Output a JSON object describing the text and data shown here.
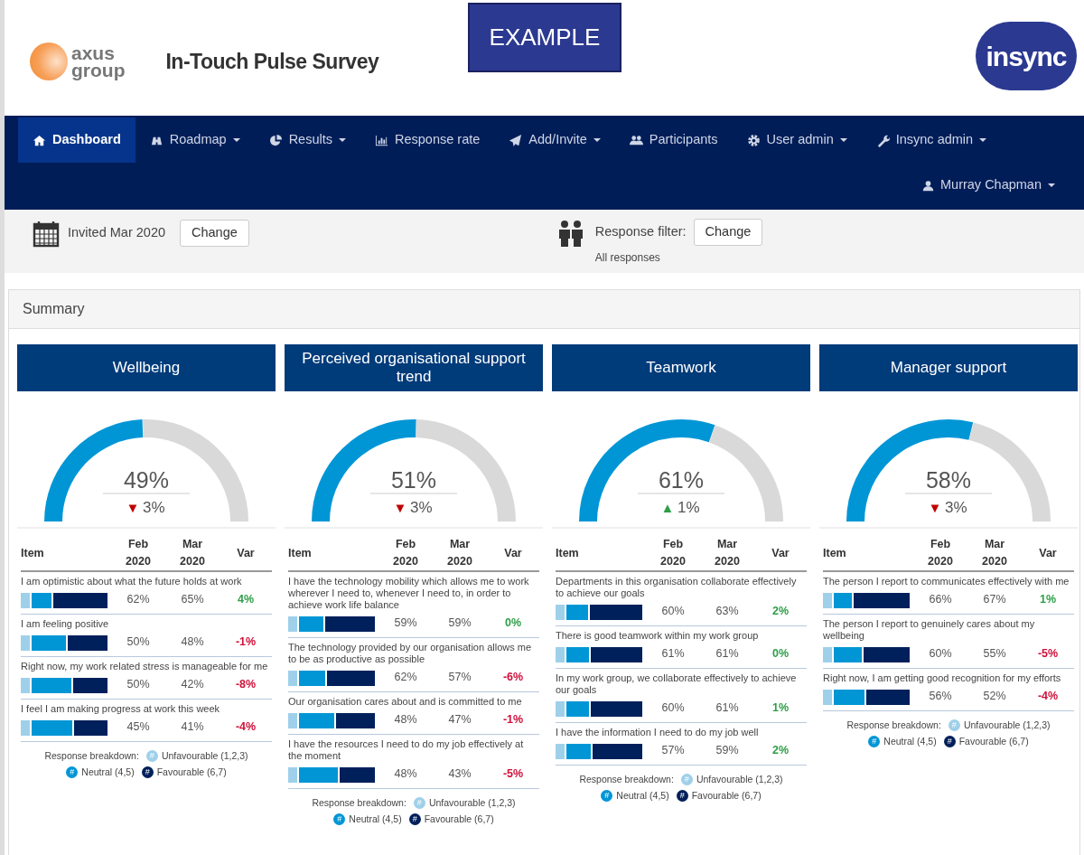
{
  "header": {
    "logo_top": "axus",
    "logo_bottom": "group",
    "title": "In-Touch Pulse Survey",
    "stamp": "EXAMPLE",
    "brand": "insync"
  },
  "nav": [
    {
      "label": "Dashboard",
      "caret": false,
      "selected": true
    },
    {
      "label": "Roadmap",
      "caret": true,
      "selected": false
    },
    {
      "label": "Results",
      "caret": true,
      "selected": false
    },
    {
      "label": "Response rate",
      "caret": false,
      "selected": false
    },
    {
      "label": "Add/Invite",
      "caret": true,
      "selected": false
    },
    {
      "label": "Participants",
      "caret": false,
      "selected": false
    },
    {
      "label": "User admin",
      "caret": true,
      "selected": false
    },
    {
      "label": "Insync admin",
      "caret": true,
      "selected": false
    }
  ],
  "user": {
    "label": "Murray Chapman",
    "caret": true
  },
  "filters": {
    "invited": "Invited Mar 2020",
    "invited_button": "Change",
    "response_label": "Response filter:",
    "response_button": "Change",
    "response_value": "All responses"
  },
  "summary": {
    "title": "Summary"
  },
  "cards": [
    {
      "title": "Wellbeing",
      "gauge": {
        "value": "49%",
        "arrow": "▼",
        "positive": false,
        "change": "3%"
      },
      "columns": [
        "Item",
        "Feb 2020",
        "Mar 2020",
        "Var"
      ],
      "items": [
        {
          "text": "I am optimistic about what the future holds at work",
          "feb": "62%",
          "mar": "65%",
          "var": "4%",
          "favourable": true
        },
        {
          "text": "I am feeling positive",
          "feb": "50%",
          "mar": "48%",
          "var": "-1%",
          "favourable": false
        },
        {
          "text": "Right now, my work related stress is manageable for me",
          "feb": "50%",
          "mar": "42%",
          "var": "-8%",
          "favourable": false
        },
        {
          "text": "I feel I am making progress at work this week",
          "feb": "45%",
          "mar": "41%",
          "var": "-4%",
          "favourable": false
        }
      ],
      "legend": {
        "label": "Response breakdown:",
        "items": [
          {
            "symbol": "#",
            "label": "Unfavourable (1,2,3)",
            "color": "#9fd0ea"
          },
          {
            "symbol": "#",
            "label": "Neutral (4,5)",
            "color": "#0096d6"
          },
          {
            "symbol": "#",
            "label": "Favourable (6,7)",
            "color": "#00205b"
          }
        ]
      }
    },
    {
      "title": "Perceived organisational support trend",
      "gauge": {
        "value": "51%",
        "arrow": "▼",
        "positive": false,
        "change": "3%"
      },
      "columns": [
        "Item",
        "Feb 2020",
        "Mar 2020",
        "Var"
      ],
      "items": [
        {
          "text": "I have the technology mobility which allows me to work wherever I need to, whenever I need to, in order to achieve work life balance",
          "feb": "59%",
          "mar": "59%",
          "var": "0%",
          "favourable": true
        },
        {
          "text": "The technology provided by our organisation allows me to be as productive as possible",
          "feb": "62%",
          "mar": "57%",
          "var": "-6%",
          "favourable": false
        },
        {
          "text": "Our organisation cares about and is committed to me",
          "feb": "48%",
          "mar": "47%",
          "var": "-1%",
          "favourable": false
        },
        {
          "text": "I have the resources I need to do my job effectively at the moment",
          "feb": "48%",
          "mar": "43%",
          "var": "-5%",
          "favourable": false
        }
      ],
      "legend": {
        "label": "Response breakdown:",
        "items": [
          {
            "symbol": "#",
            "label": "Unfavourable (1,2,3)",
            "color": "#9fd0ea"
          },
          {
            "symbol": "#",
            "label": "Neutral (4,5)",
            "color": "#0096d6"
          },
          {
            "symbol": "#",
            "label": "Favourable (6,7)",
            "color": "#00205b"
          }
        ]
      }
    },
    {
      "title": "Teamwork",
      "gauge": {
        "value": "61%",
        "arrow": "▲",
        "positive": true,
        "change": "1%"
      },
      "columns": [
        "Item",
        "Feb 2020",
        "Mar 2020",
        "Var"
      ],
      "items": [
        {
          "text": "Departments in this organisation collaborate effectively to achieve our goals",
          "feb": "60%",
          "mar": "63%",
          "var": "2%",
          "favourable": true
        },
        {
          "text": "There is good teamwork within my work group",
          "feb": "61%",
          "mar": "61%",
          "var": "0%",
          "favourable": true
        },
        {
          "text": "In my work group, we collaborate effectively to achieve our goals",
          "feb": "60%",
          "mar": "61%",
          "var": "1%",
          "favourable": true
        },
        {
          "text": "I have the information I need to do my job well",
          "feb": "57%",
          "mar": "59%",
          "var": "2%",
          "favourable": true
        }
      ],
      "legend": {
        "label": "Response breakdown:",
        "items": [
          {
            "symbol": "#",
            "label": "Unfavourable (1,2,3)",
            "color": "#9fd0ea"
          },
          {
            "symbol": "#",
            "label": "Neutral (4,5)",
            "color": "#0096d6"
          },
          {
            "symbol": "#",
            "label": "Favourable (6,7)",
            "color": "#00205b"
          }
        ]
      }
    },
    {
      "title": "Manager support",
      "gauge": {
        "value": "58%",
        "arrow": "▼",
        "positive": false,
        "change": "3%"
      },
      "columns": [
        "Item",
        "Feb 2020",
        "Mar 2020",
        "Var"
      ],
      "items": [
        {
          "text": "The person I report to communicates effectively with me",
          "feb": "66%",
          "mar": "67%",
          "var": "1%",
          "favourable": true
        },
        {
          "text": "The person I report to genuinely cares about my wellbeing",
          "feb": "60%",
          "mar": "55%",
          "var": "-5%",
          "favourable": false
        },
        {
          "text": "Right now, I am getting good recognition for my efforts",
          "feb": "56%",
          "mar": "52%",
          "var": "-4%",
          "favourable": false
        }
      ],
      "legend": {
        "label": "Response breakdown:",
        "items": [
          {
            "symbol": "#",
            "label": "Unfavourable (1,2,3)",
            "color": "#9fd0ea"
          },
          {
            "symbol": "#",
            "label": "Neutral (4,5)",
            "color": "#0096d6"
          },
          {
            "symbol": "#",
            "label": "Favourable (6,7)",
            "color": "#00205b"
          }
        ]
      }
    }
  ]
}
